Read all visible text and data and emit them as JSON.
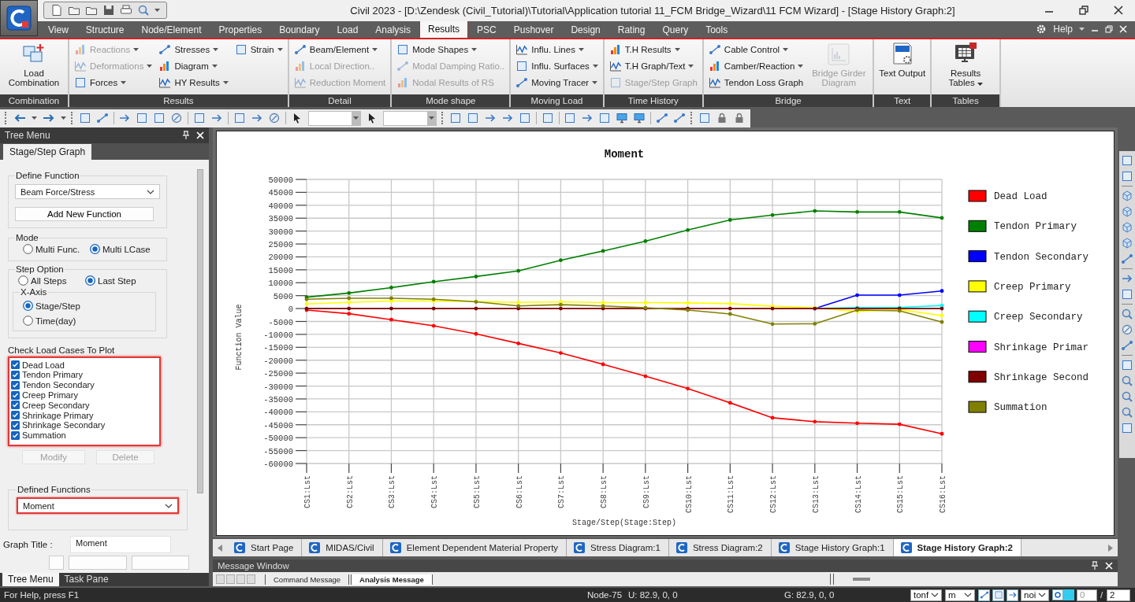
{
  "window": {
    "title": "Civil 2023 - [D:\\Zendesk (Civil_Tutorial)\\Tutorial\\Application tutorial 11_FCM Bridge_Wizard\\11 FCM Wizard] - [Stage History Graph:2]"
  },
  "menu_tabs": [
    {
      "label": "View",
      "selected": false
    },
    {
      "label": "Structure",
      "selected": false
    },
    {
      "label": "Node/Element",
      "selected": false
    },
    {
      "label": "Properties",
      "selected": false
    },
    {
      "label": "Boundary",
      "selected": false
    },
    {
      "label": "Load",
      "selected": false
    },
    {
      "label": "Analysis",
      "selected": false
    },
    {
      "label": "Results",
      "selected": true
    },
    {
      "label": "PSC",
      "selected": false
    },
    {
      "label": "Pushover",
      "selected": false
    },
    {
      "label": "Design",
      "selected": false
    },
    {
      "label": "Rating",
      "selected": false
    },
    {
      "label": "Query",
      "selected": false
    },
    {
      "label": "Tools",
      "selected": false
    }
  ],
  "help": {
    "label": "Help"
  },
  "ribbon_groups": [
    {
      "label": "Combination",
      "columns": [
        [
          {
            "label": "Load Combination",
            "kind": "large",
            "disabled": false,
            "dropdown": false
          }
        ]
      ]
    },
    {
      "label": "Results",
      "columns": [
        [
          {
            "label": "Reactions",
            "kind": "small",
            "disabled": true,
            "dropdown": true
          },
          {
            "label": "Deformations",
            "kind": "small",
            "disabled": true,
            "dropdown": true
          },
          {
            "label": "Forces",
            "kind": "small",
            "disabled": false,
            "dropdown": true
          }
        ],
        [
          {
            "label": "Stresses",
            "kind": "small",
            "disabled": false,
            "dropdown": true
          },
          {
            "label": "Diagram",
            "kind": "small",
            "disabled": false,
            "dropdown": true
          },
          {
            "label": "HY Results",
            "kind": "small",
            "disabled": false,
            "dropdown": true
          }
        ],
        [
          {
            "label": "Strain",
            "kind": "small",
            "disabled": false,
            "dropdown": true
          }
        ]
      ]
    },
    {
      "label": "Detail",
      "columns": [
        [
          {
            "label": "Beam/Element",
            "kind": "small",
            "disabled": false,
            "dropdown": true
          },
          {
            "label": "Local Direction..",
            "kind": "small",
            "disabled": true,
            "dropdown": false
          },
          {
            "label": "Reduction Moment",
            "kind": "small",
            "disabled": true,
            "dropdown": false
          }
        ]
      ]
    },
    {
      "label": "Mode shape",
      "columns": [
        [
          {
            "label": "Mode Shapes",
            "kind": "small",
            "disabled": false,
            "dropdown": true
          },
          {
            "label": "Modal Damping Ratio..",
            "kind": "small",
            "disabled": true,
            "dropdown": false
          },
          {
            "label": "Nodal Results of RS",
            "kind": "small",
            "disabled": true,
            "dropdown": false
          }
        ]
      ]
    },
    {
      "label": "Moving Load",
      "columns": [
        [
          {
            "label": "Influ. Lines",
            "kind": "small",
            "disabled": false,
            "dropdown": true
          },
          {
            "label": "Influ. Surfaces",
            "kind": "small",
            "disabled": false,
            "dropdown": true
          },
          {
            "label": "Moving Tracer",
            "kind": "small",
            "disabled": false,
            "dropdown": true
          }
        ]
      ]
    },
    {
      "label": "Time History",
      "columns": [
        [
          {
            "label": "T.H Results",
            "kind": "small",
            "disabled": false,
            "dropdown": true
          },
          {
            "label": "T.H Graph/Text",
            "kind": "small",
            "disabled": false,
            "dropdown": true
          },
          {
            "label": "Stage/Step Graph",
            "kind": "small",
            "disabled": true,
            "dropdown": false
          }
        ]
      ]
    },
    {
      "label": "Bridge",
      "columns": [
        [
          {
            "label": "Cable Control",
            "kind": "small",
            "disabled": false,
            "dropdown": true
          },
          {
            "label": "Camber/Reaction",
            "kind": "small",
            "disabled": false,
            "dropdown": true
          },
          {
            "label": "Tendon Loss Graph",
            "kind": "small",
            "disabled": false,
            "dropdown": false
          }
        ],
        [
          {
            "label": "Bridge Girder Diagram",
            "kind": "large",
            "disabled": true,
            "dropdown": false
          }
        ]
      ]
    },
    {
      "label": "Text",
      "columns": [
        [
          {
            "label": "Text Output",
            "kind": "large",
            "disabled": false,
            "dropdown": false
          }
        ]
      ]
    },
    {
      "label": "Tables",
      "columns": [
        [
          {
            "label": "Results Tables",
            "kind": "large",
            "disabled": false,
            "dropdown": true
          }
        ]
      ]
    }
  ],
  "tree_panel": {
    "title": "Tree Menu",
    "tab": "Stage/Step Graph",
    "define_function": {
      "label": "Define Function",
      "value": "Beam Force/Stress",
      "button": "Add New Function"
    },
    "mode": {
      "label": "Mode",
      "options": [
        {
          "label": "Multi Func.",
          "selected": false
        },
        {
          "label": "Multi LCase",
          "selected": true
        }
      ]
    },
    "step_option": {
      "label": "Step Option",
      "options": [
        {
          "label": "All Steps",
          "selected": false
        },
        {
          "label": "Last Step",
          "selected": true
        }
      ]
    },
    "x_axis": {
      "label": "X-Axis",
      "options": [
        {
          "label": "Stage/Step",
          "selected": true
        },
        {
          "label": "Time(day)",
          "selected": false
        }
      ]
    },
    "load_cases": {
      "label": "Check Load Cases To Plot",
      "items": [
        {
          "label": "Dead Load",
          "checked": true
        },
        {
          "label": "Tendon Primary",
          "checked": true
        },
        {
          "label": "Tendon Secondary",
          "checked": true
        },
        {
          "label": "Creep Primary",
          "checked": true
        },
        {
          "label": "Creep Secondary",
          "checked": true
        },
        {
          "label": "Shrinkage Primary",
          "checked": true
        },
        {
          "label": "Shrinkage Secondary",
          "checked": true
        },
        {
          "label": "Summation",
          "checked": true
        }
      ]
    },
    "buttons": [
      {
        "label": "Modify",
        "disabled": true
      },
      {
        "label": "Delete",
        "disabled": true
      }
    ],
    "defined_functions": {
      "label": "Defined Functions",
      "value": "Moment"
    },
    "graph_title": {
      "label": "Graph Title :",
      "value": "Moment"
    },
    "bottom_tabs": [
      {
        "label": "Tree Menu",
        "selected": true
      },
      {
        "label": "Task Pane",
        "selected": false
      }
    ]
  },
  "chart": {
    "chart_data": {
      "type": "line",
      "title": "Moment",
      "xlabel": "Stage/Step(Stage:Step)",
      "ylabel": "Function Value",
      "categories": [
        "CS1:Lst",
        "CS2:Lst",
        "CS3:Lst",
        "CS4:Lst",
        "CS5:Lst",
        "CS6:Lst",
        "CS7:Lst",
        "CS8:Lst",
        "CS9:Lst",
        "CS10:Lst",
        "CS11:Lst",
        "CS12:Lst",
        "CS13:Lst",
        "CS14:Lst",
        "CS15:Lst",
        "CS16:Lst"
      ],
      "ylim": [
        -60000,
        50000
      ],
      "grid": true,
      "legend": "right",
      "yticks": [
        -60000,
        -55000,
        -50000,
        -45000,
        -40000,
        -35000,
        -30000,
        -25000,
        -20000,
        -15000,
        -10000,
        -5000,
        0,
        5000,
        10000,
        15000,
        20000,
        25000,
        30000,
        35000,
        40000,
        45000,
        50000
      ],
      "series": [
        {
          "name": "Dead Load",
          "color": "#ff0000",
          "values": [
            -600,
            -2000,
            -4300,
            -6700,
            -9800,
            -13500,
            -17200,
            -21600,
            -26200,
            -31000,
            -36500,
            -42300,
            -43800,
            -44400,
            -44800,
            -48500
          ]
        },
        {
          "name": "Tendon Primary",
          "color": "#008000",
          "values": [
            4400,
            6000,
            8100,
            10400,
            12400,
            14600,
            18700,
            22300,
            26100,
            30400,
            34300,
            36200,
            37800,
            37400,
            37400,
            35100
          ]
        },
        {
          "name": "Tendon Secondary",
          "color": "#0000ff",
          "values": [
            null,
            null,
            null,
            null,
            null,
            null,
            null,
            null,
            null,
            null,
            null,
            null,
            0,
            5200,
            5200,
            6800
          ]
        },
        {
          "name": "Creep Primary",
          "color": "#ffff00",
          "values": [
            1800,
            2400,
            2900,
            2900,
            2700,
            2400,
            2600,
            2300,
            2300,
            2200,
            1900,
            900,
            300,
            -1100,
            -400,
            -2700
          ]
        },
        {
          "name": "Creep Secondary",
          "color": "#00ffff",
          "values": [
            null,
            null,
            null,
            null,
            null,
            null,
            null,
            null,
            null,
            null,
            null,
            null,
            0,
            400,
            400,
            1200
          ]
        },
        {
          "name": "Shrinkage Primar",
          "color": "#ff00ff",
          "values": [
            null,
            null,
            null,
            null,
            null,
            null,
            null,
            null,
            null,
            null,
            null,
            null,
            null,
            null,
            null,
            null
          ]
        },
        {
          "name": "Shrinkage Second",
          "color": "#800000",
          "values": [
            0,
            0,
            0,
            0,
            0,
            0,
            0,
            0,
            0,
            0,
            0,
            0,
            0,
            0,
            0,
            0
          ]
        },
        {
          "name": "Summation",
          "color": "#808000",
          "values": [
            3600,
            4000,
            4000,
            3600,
            2600,
            1000,
            1500,
            1000,
            300,
            -600,
            -2100,
            -6000,
            -5900,
            -600,
            -900,
            -5200
          ]
        }
      ]
    }
  },
  "document_tabs": [
    {
      "label": "Start Page",
      "selected": false
    },
    {
      "label": "MIDAS/Civil",
      "selected": false
    },
    {
      "label": "Element Dependent Material Property",
      "selected": false
    },
    {
      "label": "Stress Diagram:1",
      "selected": false
    },
    {
      "label": "Stress Diagram:2",
      "selected": false
    },
    {
      "label": "Stage History Graph:1",
      "selected": false
    },
    {
      "label": "Stage History Graph:2",
      "selected": true
    }
  ],
  "message_window": {
    "title": "Message Window",
    "tabs": [
      {
        "label": "Command Message",
        "selected": false
      },
      {
        "label": "Analysis Message",
        "selected": true
      }
    ]
  },
  "status_bar": {
    "help": "For Help, press F1",
    "node": "Node-75",
    "ucs": "U: 82.9, 0, 0",
    "gcs": "G: 82.9, 0, 0",
    "force_unit": "tonf",
    "length_unit": "m",
    "filter": "noi",
    "spin_value": "0",
    "separator": "/",
    "page": "2"
  }
}
